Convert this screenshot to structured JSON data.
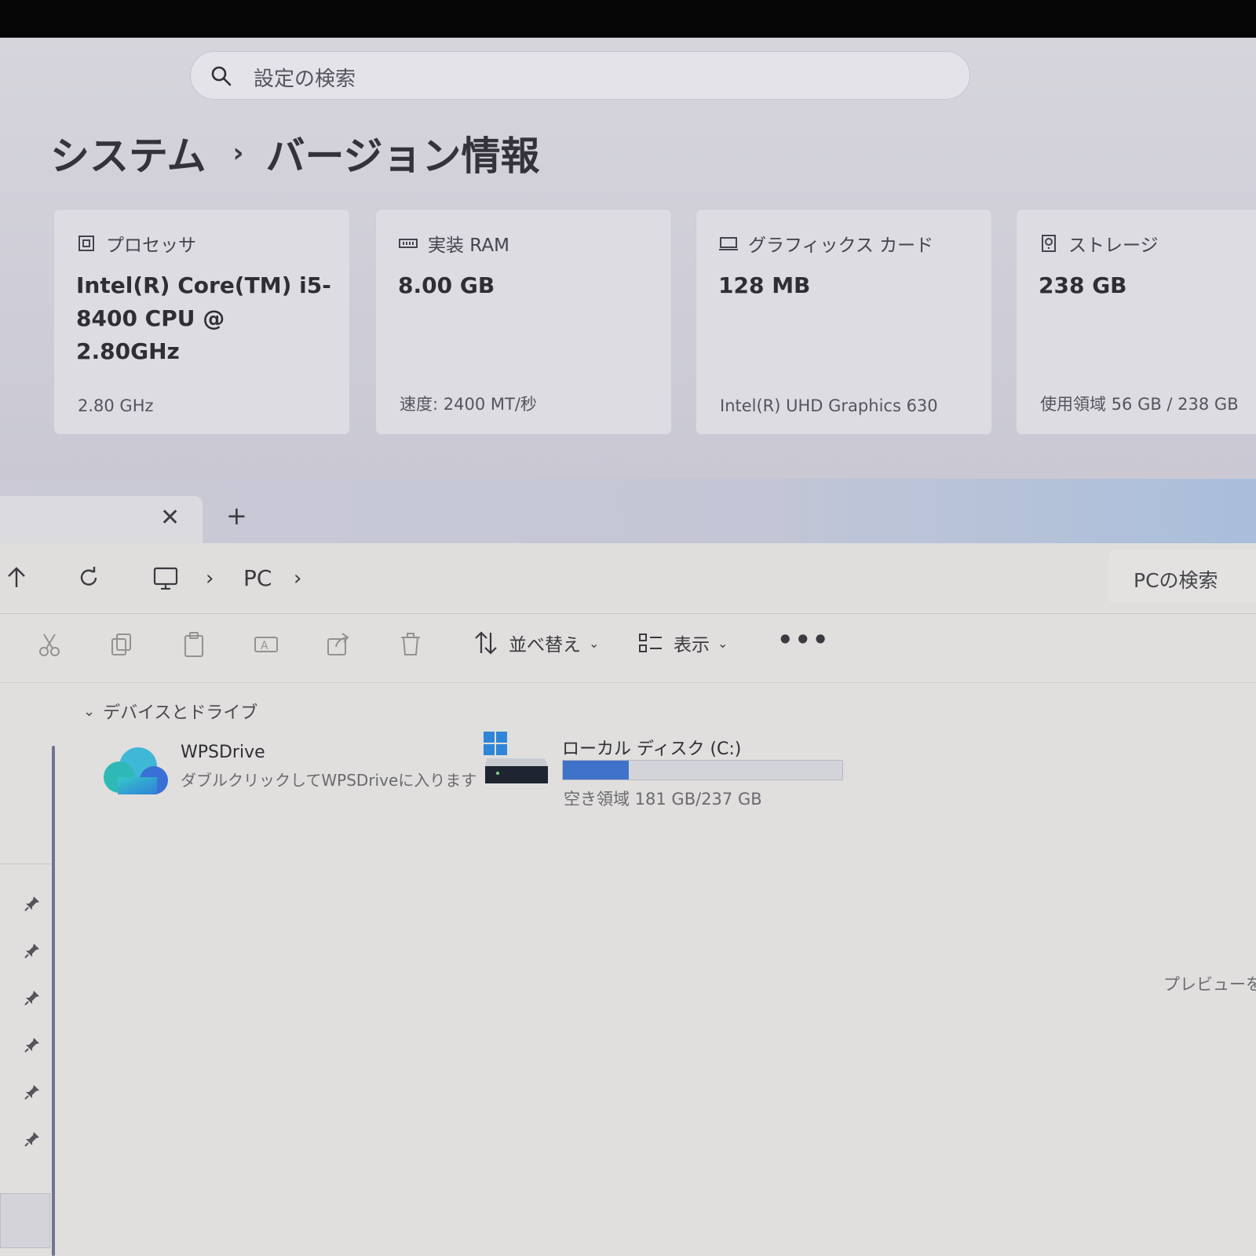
{
  "settings": {
    "search_placeholder": "設定の検索",
    "breadcrumb": [
      "システム",
      "バージョン情報"
    ],
    "cards": [
      {
        "label": "プロセッサ",
        "value": "Intel(R) Core(TM) i5-8400 CPU @ 2.80GHz",
        "detail": "2.80 GHz",
        "icon": "cpu-icon"
      },
      {
        "label": "実装 RAM",
        "value": "8.00 GB",
        "detail": "速度: 2400 MT/秒",
        "icon": "ram-icon"
      },
      {
        "label": "グラフィックス カード",
        "value": "128 MB",
        "detail": "Intel(R) UHD Graphics 630",
        "icon": "gpu-icon"
      },
      {
        "label": "ストレージ",
        "value": "238 GB",
        "detail": "使用領域 56 GB / 238 GB",
        "icon": "storage-icon"
      }
    ]
  },
  "explorer": {
    "tab_close": "✕",
    "new_tab": "+",
    "address": {
      "location": "PC",
      "search_placeholder": "PCの検索"
    },
    "toolbar": {
      "sort_label": "並べ替え",
      "view_label": "表示",
      "more": "•••"
    },
    "group_label": "デバイスとドライブ",
    "items": [
      {
        "name": "WPSDrive",
        "description": "ダブルクリックしてWPSDriveに入ります",
        "icon": "cloud-icon"
      },
      {
        "name": "ローカル ディスク (C:)",
        "free_text": "空き領域 181 GB/237 GB",
        "used_fraction": 0.236,
        "icon": "windows-drive-icon"
      }
    ],
    "preview_hint": "プレビューを表"
  },
  "colors": {
    "accent": "#3f73c9",
    "window": "#e0dfdd",
    "settings_bg": "#d2d1da"
  }
}
